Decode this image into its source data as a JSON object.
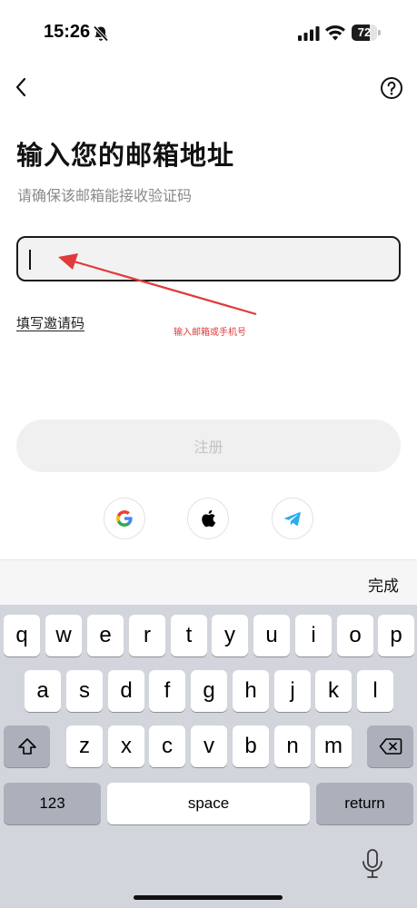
{
  "status_bar": {
    "time": "15:26",
    "battery": "72",
    "battery_fraction": 0.72,
    "icons": [
      "bell-muted-icon",
      "signal-icon",
      "wifi-icon",
      "battery-icon"
    ]
  },
  "nav": {
    "back_icon": "chevron-left-icon",
    "help_icon": "question-circle-icon"
  },
  "page": {
    "title": "输入您的邮箱地址",
    "subtitle": "请确保该邮箱能接收验证码"
  },
  "email_input": {
    "value": "",
    "placeholder": ""
  },
  "invite_link": "填写邀请码",
  "annotation": {
    "text": "输入邮箱或手机号",
    "color": "#e03a3a"
  },
  "register_button": "注册",
  "social_logins": [
    "google-icon",
    "apple-icon",
    "telegram-icon"
  ],
  "keyboard": {
    "done": "完成",
    "row1": [
      "q",
      "w",
      "e",
      "r",
      "t",
      "y",
      "u",
      "i",
      "o",
      "p"
    ],
    "row2": [
      "a",
      "s",
      "d",
      "f",
      "g",
      "h",
      "j",
      "k",
      "l"
    ],
    "row3": [
      "z",
      "x",
      "c",
      "v",
      "b",
      "n",
      "m"
    ],
    "numbers_key": "123",
    "space_key": "space",
    "return_key": "return"
  }
}
